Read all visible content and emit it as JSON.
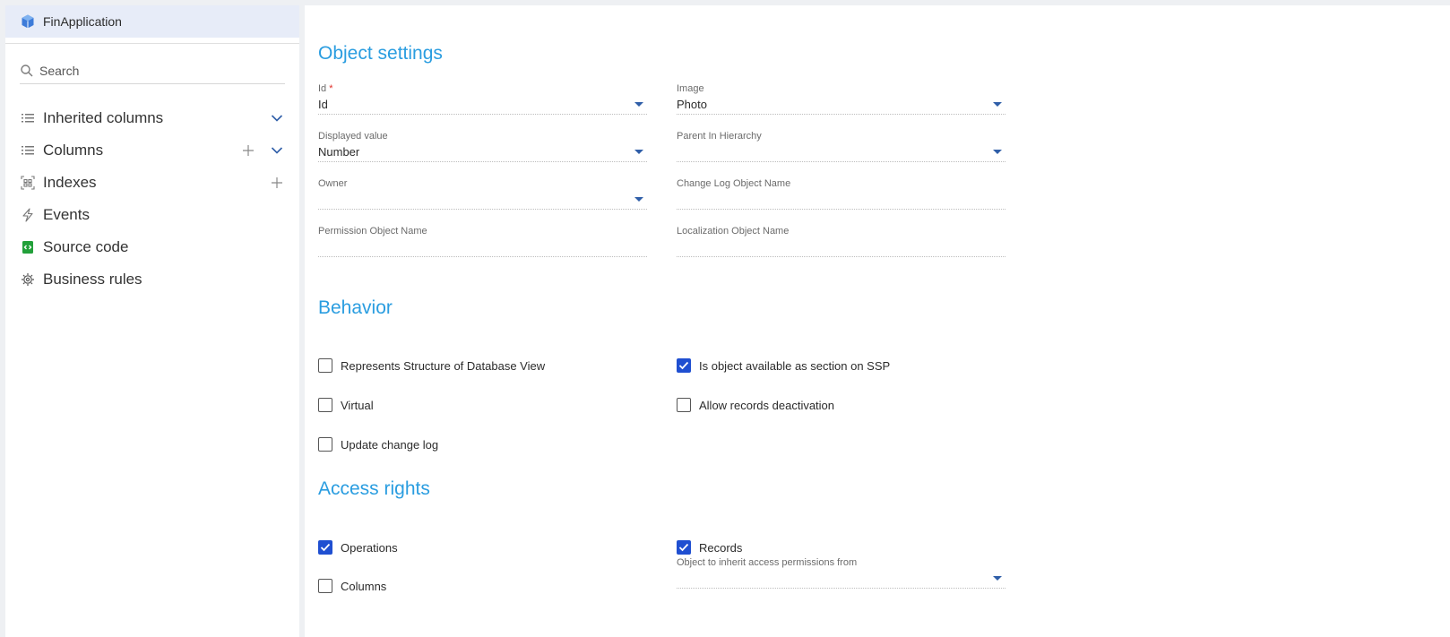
{
  "sidebar": {
    "title": "FinApplication",
    "search_placeholder": "Search",
    "items": [
      {
        "label": "Inherited columns"
      },
      {
        "label": "Columns"
      },
      {
        "label": "Indexes"
      },
      {
        "label": "Events"
      },
      {
        "label": "Source code"
      },
      {
        "label": "Business rules"
      }
    ]
  },
  "main": {
    "object_settings": {
      "title": "Object settings",
      "id_label": "Id",
      "id_value": "Id",
      "image_label": "Image",
      "image_value": "Photo",
      "displayed_value_label": "Displayed value",
      "displayed_value_value": "Number",
      "parent_label": "Parent In Hierarchy",
      "parent_value": "",
      "owner_label": "Owner",
      "owner_value": "",
      "change_log_label": "Change Log Object Name",
      "change_log_value": "",
      "permission_label": "Permission Object Name",
      "permission_value": "",
      "localization_label": "Localization Object Name",
      "localization_value": ""
    },
    "behavior": {
      "title": "Behavior",
      "represents_structure": {
        "label": "Represents Structure of Database View",
        "checked": false
      },
      "ssp_section": {
        "label": "Is object available as section on SSP",
        "checked": true
      },
      "virtual": {
        "label": "Virtual",
        "checked": false
      },
      "allow_deactivation": {
        "label": "Allow records deactivation",
        "checked": false
      },
      "update_change_log": {
        "label": "Update change log",
        "checked": false
      }
    },
    "access_rights": {
      "title": "Access rights",
      "operations": {
        "label": "Operations",
        "checked": true
      },
      "records": {
        "label": "Records",
        "checked": true
      },
      "columns": {
        "label": "Columns",
        "checked": false
      },
      "inherit_label": "Object to inherit access permissions from",
      "inherit_value": ""
    }
  },
  "colors": {
    "accent": "#2a9de0",
    "checkbox": "#1f4fd1",
    "header_bg": "#e7ecf8"
  }
}
